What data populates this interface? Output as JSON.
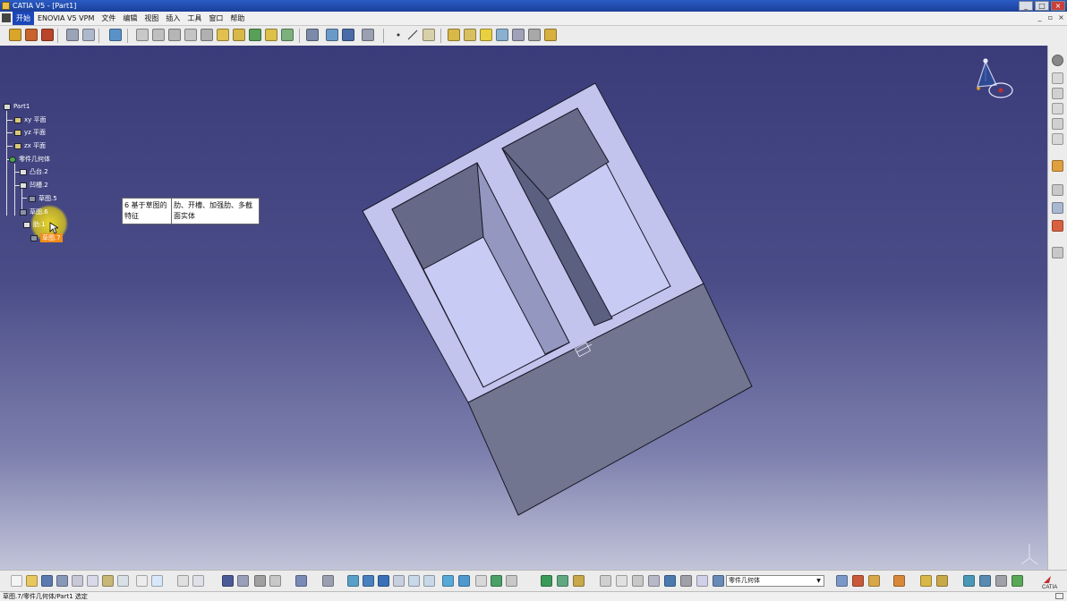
{
  "window": {
    "title": "CATIA V5 - [Part1]"
  },
  "menu": {
    "items": [
      "开始",
      "ENOVIA V5 VPM",
      "文件",
      "编辑",
      "视图",
      "插入",
      "工具",
      "窗口",
      "帮助"
    ]
  },
  "tree": {
    "root": "Part1",
    "planes": [
      "xy 平面",
      "yz 平面",
      "zx 平面"
    ],
    "body": "零件几何体",
    "pad": "凸台.2",
    "pocket": "凹槽.2",
    "sketch_a": "草图.5",
    "sketch_b": "草图.6",
    "rib_partial": "肋.1",
    "sketch_selected": "草图.7"
  },
  "tooltip": {
    "category": "6 基于草图的特征",
    "items": "肋、开槽、加强肋、多截面实体"
  },
  "work_object": "零件几何体",
  "status": {
    "text": "草图.7/零件几何体/Part1 选定"
  },
  "brand": {
    "logo": "CATIA"
  },
  "icons": {
    "compass": "compass-icon",
    "axis": "axis-triad-icon"
  }
}
